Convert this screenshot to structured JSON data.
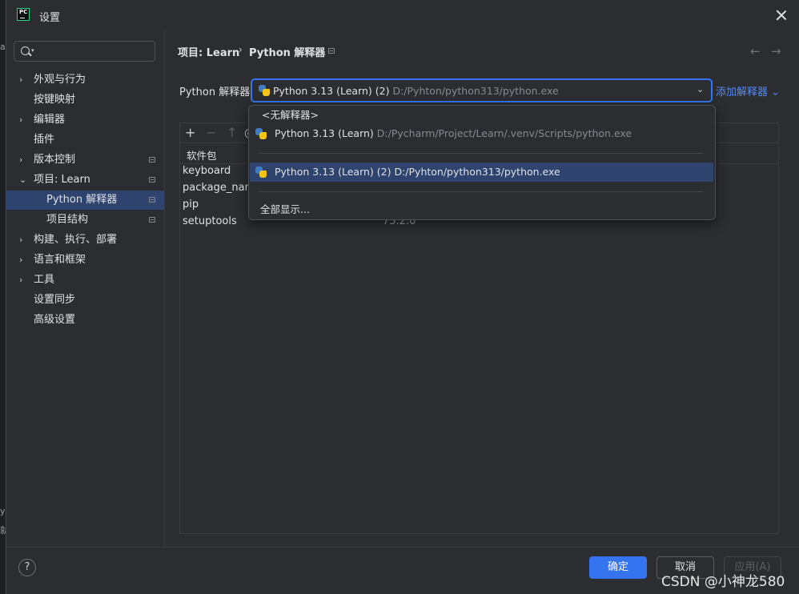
{
  "window": {
    "title": "设置",
    "app_icon_text": "PC"
  },
  "search": {
    "placeholder": ""
  },
  "sidebar": {
    "items": [
      {
        "label": "外观与行为",
        "chevron": true
      },
      {
        "label": "按键映射",
        "chevron": false
      },
      {
        "label": "编辑器",
        "chevron": true
      },
      {
        "label": "插件",
        "chevron": false
      },
      {
        "label": "版本控制",
        "chevron": true
      },
      {
        "label": "项目: Learn",
        "chevron": true,
        "expanded": true
      },
      {
        "label": "Python 解释器",
        "child": true,
        "selected": true
      },
      {
        "label": "项目结构",
        "child": true
      },
      {
        "label": "构建、执行、部署",
        "chevron": true
      },
      {
        "label": "语言和框架",
        "chevron": true
      },
      {
        "label": "工具",
        "chevron": true
      },
      {
        "label": "设置同步",
        "chevron": false
      },
      {
        "label": "高级设置",
        "chevron": false
      }
    ]
  },
  "breadcrumb": {
    "project": "项目: Learn",
    "separator": "›",
    "page": "Python 解释器"
  },
  "nav": {
    "back": "←",
    "forward": "→"
  },
  "interpreter": {
    "label": "Python 解释器:",
    "selected_name": "Python 3.13 (Learn) (2)",
    "selected_path": "D:/Pyhton/python313/python.exe",
    "add_label": "添加解释器"
  },
  "dropdown": {
    "none_label": "<无解释器>",
    "options": [
      {
        "name": "Python 3.13 (Learn)",
        "path": "D:/Pycharm/Project/Learn/.venv/Scripts/python.exe"
      },
      {
        "name": "Python 3.13 (Learn) (2)",
        "path": "D:/Pyhton/python313/python.exe"
      }
    ],
    "show_all": "全部显示..."
  },
  "packages": {
    "toolbar": {
      "add": "+",
      "remove": "−",
      "upgrade": "↑",
      "more": "◎"
    },
    "column_header": "软件包",
    "rows": [
      {
        "name": "keyboard",
        "version": ""
      },
      {
        "name": "package_name",
        "version": ""
      },
      {
        "name": "pip",
        "version": ""
      },
      {
        "name": "setuptools",
        "version": "75.2.0"
      }
    ]
  },
  "footer": {
    "help": "?",
    "ok": "确定",
    "cancel": "取消",
    "apply": "应用(A)"
  },
  "watermark": "CSDN @小神龙580",
  "edge_fragments": [
    "a",
    "y",
    "就"
  ],
  "colors": {
    "accent": "#3574f0",
    "selection": "#2e436e",
    "link": "#548af7",
    "background": "#2b2d30"
  }
}
